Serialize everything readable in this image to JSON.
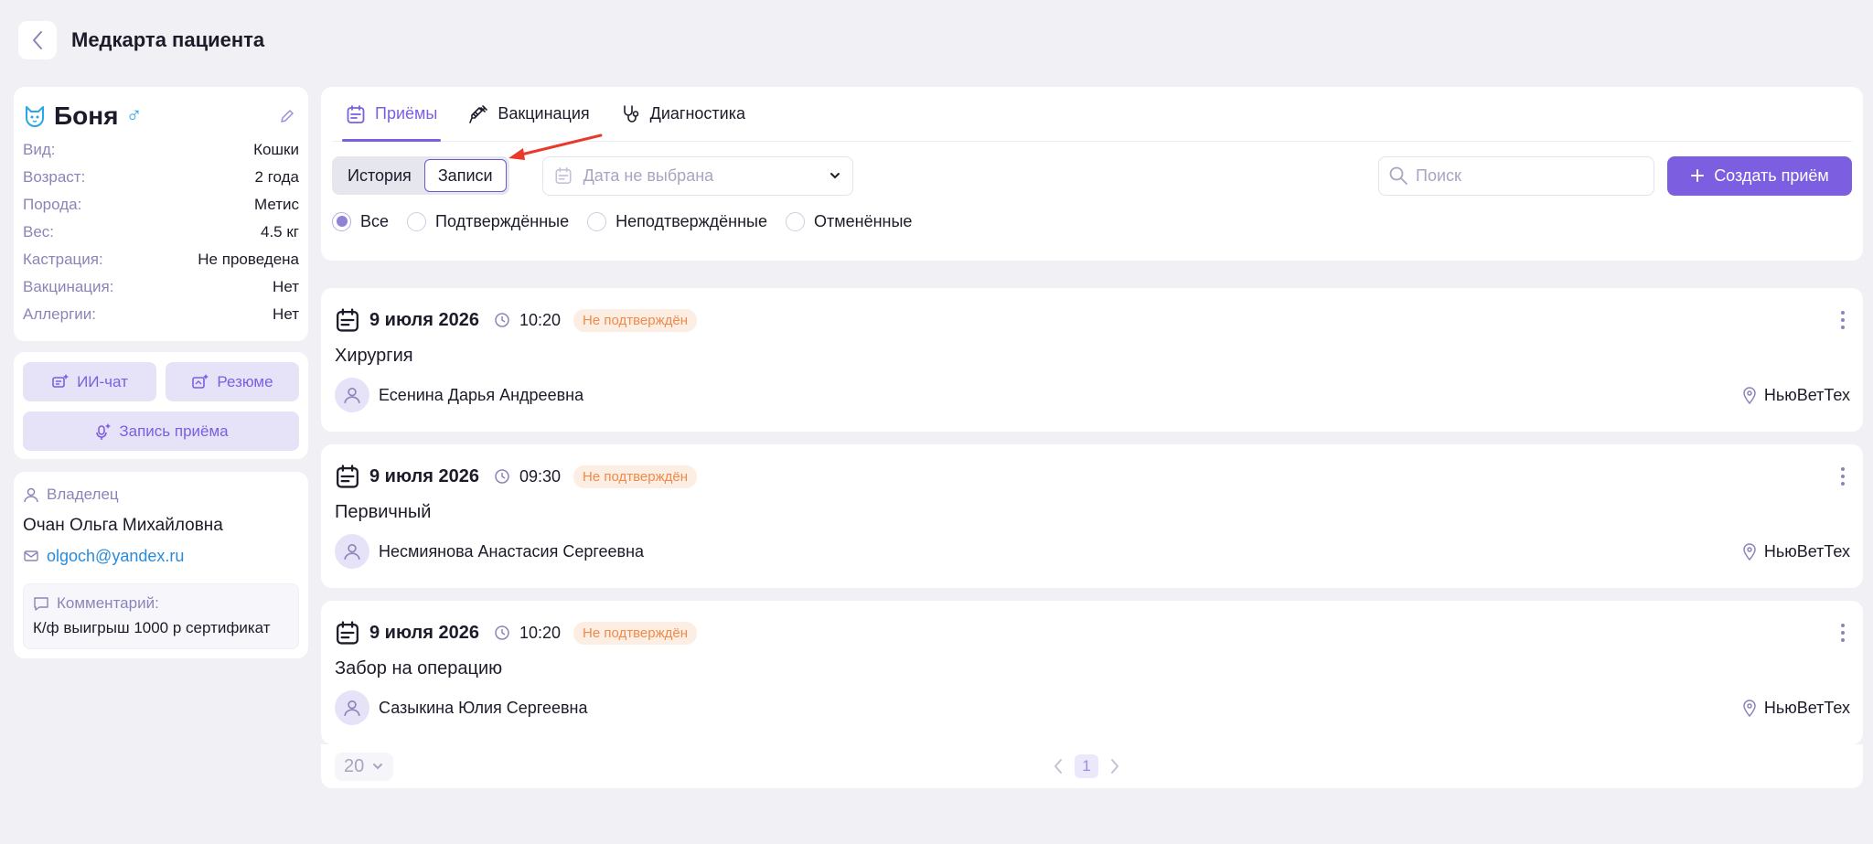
{
  "header": {
    "title": "Медкарта пациента"
  },
  "pet": {
    "name": "Боня",
    "sex_symbol": "♂",
    "fields": [
      {
        "label": "Вид:",
        "value": "Кошки"
      },
      {
        "label": "Возраст:",
        "value": "2 года"
      },
      {
        "label": "Порода:",
        "value": "Метис"
      },
      {
        "label": "Вес:",
        "value": "4.5 кг"
      },
      {
        "label": "Кастрация:",
        "value": "Не проведена"
      },
      {
        "label": "Вакцинация:",
        "value": "Нет"
      },
      {
        "label": "Аллергии:",
        "value": "Нет"
      }
    ]
  },
  "actions": {
    "ai_chat": "ИИ-чат",
    "summary": "Резюме",
    "record": "Запись приёма"
  },
  "owner": {
    "label": "Владелец",
    "name": "Очан Ольга Михайловна",
    "email": "olgoch@yandex.ru",
    "comment_label": "Комментарий:",
    "comment": "К/ф выигрыш 1000 р сертификат"
  },
  "tabs": [
    {
      "label": "Приёмы",
      "icon": "calendar-icon",
      "active": true
    },
    {
      "label": "Вакцинация",
      "icon": "syringe-icon",
      "active": false
    },
    {
      "label": "Диагностика",
      "icon": "stethoscope-icon",
      "active": false
    }
  ],
  "segment": {
    "history": "История",
    "records": "Записи",
    "active": "records"
  },
  "date_filter": {
    "placeholder": "Дата не выбрана"
  },
  "search": {
    "placeholder": "Поиск",
    "value": ""
  },
  "create_button": {
    "label": "Создать приём"
  },
  "status_filters": [
    {
      "label": "Все",
      "checked": true
    },
    {
      "label": "Подтверждённые",
      "checked": false
    },
    {
      "label": "Неподтверждённые",
      "checked": false
    },
    {
      "label": "Отменённые",
      "checked": false
    }
  ],
  "appointments": [
    {
      "date": "9 июля 2026",
      "time": "10:20",
      "status": "Не подтверждён",
      "type": "Хирургия",
      "doctor": "Есенина Дарья Андреевна",
      "clinic": "НьюВетТех"
    },
    {
      "date": "9 июля 2026",
      "time": "09:30",
      "status": "Не подтверждён",
      "type": "Первичный",
      "doctor": "Несмиянова Анастасия Сергеевна",
      "clinic": "НьюВетТех"
    },
    {
      "date": "9 июля 2026",
      "time": "10:20",
      "status": "Не подтверждён",
      "type": "Забор на операцию",
      "doctor": "Сазыкина Юлия Сергеевна",
      "clinic": "НьюВетТех"
    }
  ],
  "pagination": {
    "per_page": "20",
    "current_page": "1"
  },
  "colors": {
    "accent": "#7b5fe0",
    "badge_text": "#f08a4b",
    "badge_bg": "#fdeee3",
    "link": "#2a8bd8",
    "annotation_arrow": "#e8392c"
  }
}
